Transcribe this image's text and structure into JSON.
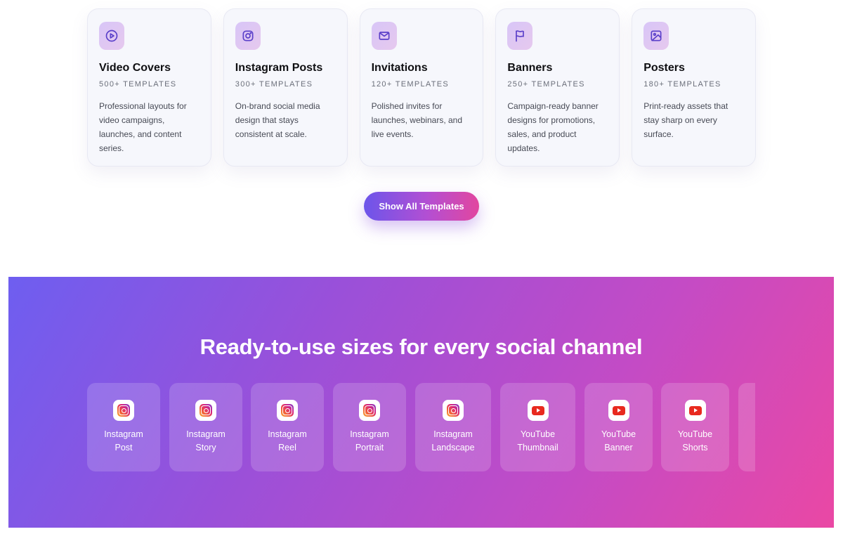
{
  "template_cards": [
    {
      "icon": "play-circle-icon",
      "title": "Video Covers",
      "count": "500+ TEMPLATES",
      "description": "Professional layouts for video campaigns, launches, and content series."
    },
    {
      "icon": "instagram-icon",
      "title": "Instagram Posts",
      "count": "300+ TEMPLATES",
      "description": "On-brand social media design that stays consistent at scale."
    },
    {
      "icon": "mail-icon",
      "title": "Invitations",
      "count": "120+ TEMPLATES",
      "description": "Polished invites for launches, webinars, and live events."
    },
    {
      "icon": "flag-icon",
      "title": "Banners",
      "count": "250+ TEMPLATES",
      "description": "Campaign-ready banner designs for promotions, sales, and product updates."
    },
    {
      "icon": "image-icon",
      "title": "Posters",
      "count": "180+ TEMPLATES",
      "description": "Print-ready assets that stay sharp on every surface."
    }
  ],
  "show_all_button": {
    "label": "Show All Templates"
  },
  "social_sizes": {
    "title": "Ready-to-use sizes for every social channel",
    "items": [
      {
        "platform": "instagram",
        "icon": "instagram-icon",
        "line1": "Instagram",
        "line2": "Post"
      },
      {
        "platform": "instagram",
        "icon": "instagram-icon",
        "line1": "Instagram",
        "line2": "Story"
      },
      {
        "platform": "instagram",
        "icon": "instagram-icon",
        "line1": "Instagram",
        "line2": "Reel"
      },
      {
        "platform": "instagram",
        "icon": "instagram-icon",
        "line1": "Instagram",
        "line2": "Portrait"
      },
      {
        "platform": "instagram",
        "icon": "instagram-icon",
        "line1": "Instagram",
        "line2": "Landscape"
      },
      {
        "platform": "youtube",
        "icon": "youtube-icon",
        "line1": "YouTube",
        "line2": "Thumbnail"
      },
      {
        "platform": "youtube",
        "icon": "youtube-icon",
        "line1": "YouTube",
        "line2": "Banner"
      },
      {
        "platform": "youtube",
        "icon": "youtube-icon",
        "line1": "YouTube",
        "line2": "Shorts"
      },
      {
        "platform": "unknown",
        "icon": "",
        "line1": "",
        "line2": ""
      }
    ]
  },
  "colors": {
    "accent_purple": "#6c55ea",
    "accent_pink": "#e2469f",
    "icon_stroke": "#5a3fc9",
    "youtube_red": "#e82a1f"
  }
}
